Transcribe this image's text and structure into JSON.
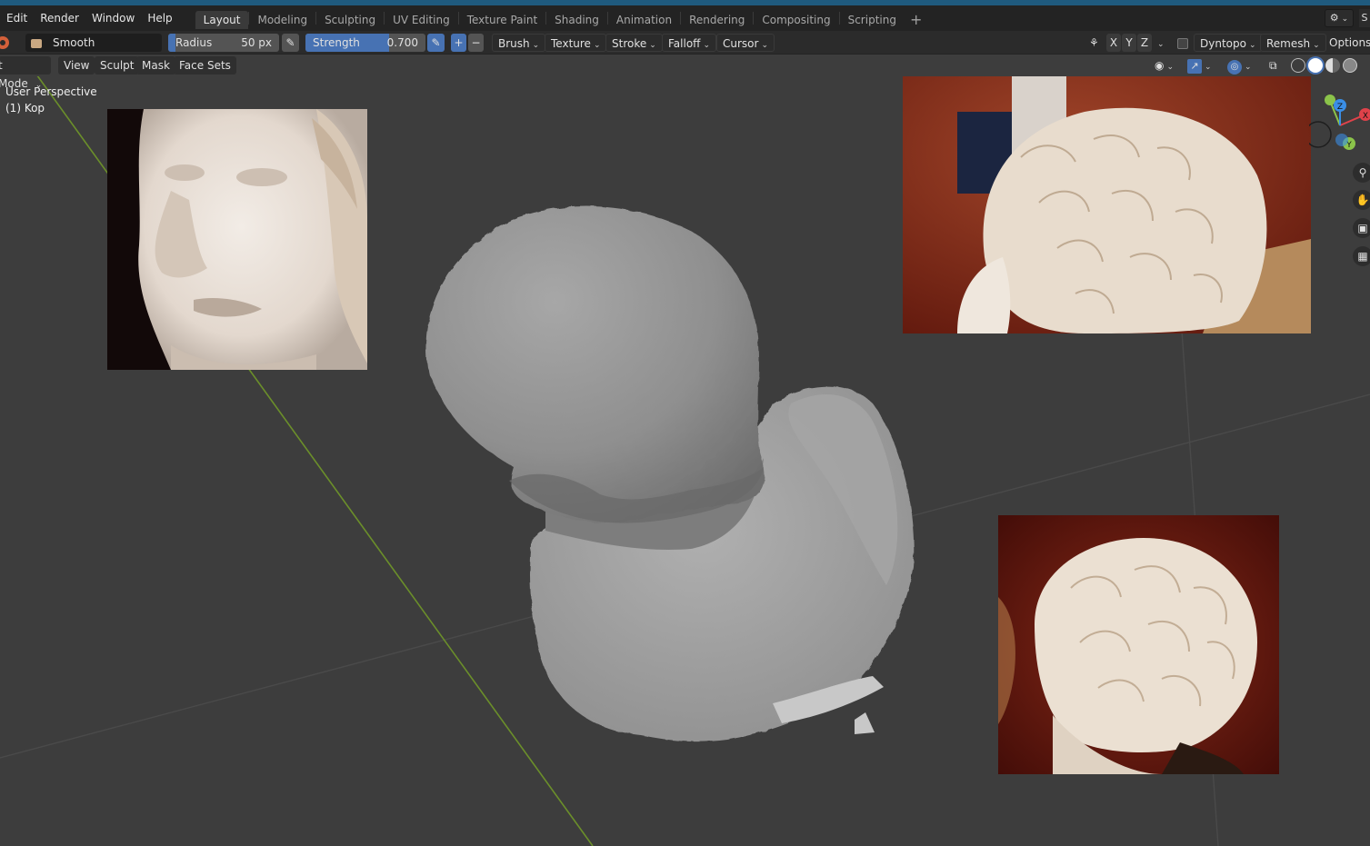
{
  "menubar": {
    "items": [
      "Edit",
      "Render",
      "Window",
      "Help"
    ],
    "workspaces": [
      "Layout",
      "Modeling",
      "Sculpting",
      "UV Editing",
      "Texture Paint",
      "Shading",
      "Animation",
      "Rendering",
      "Compositing",
      "Scripting"
    ],
    "active_workspace": "Layout",
    "add_symbol": "+",
    "right_edge": "S"
  },
  "tool_header": {
    "brush_name": "Smooth",
    "radius": {
      "label": "Radius",
      "value": "50 px"
    },
    "strength": {
      "label": "Strength",
      "value": "0.700",
      "level": 0.7
    },
    "plus": "+",
    "minus": "−",
    "dropdowns": [
      "Brush",
      "Texture",
      "Stroke",
      "Falloff",
      "Cursor"
    ],
    "axes": [
      "X",
      "Y",
      "Z"
    ],
    "dyntopo": "Dyntopo",
    "remesh": "Remesh",
    "options": "Options"
  },
  "viewport_header": {
    "mode": "t Mode",
    "menus": [
      "View",
      "Sculpt",
      "Mask",
      "Face Sets"
    ]
  },
  "viewport": {
    "perspective_label": "User Perspective",
    "object_label": "(1) Kop"
  },
  "gizmo": {
    "axes": [
      "X",
      "Y",
      "Z"
    ]
  },
  "colors": {
    "accent": "#4772b3",
    "background": "#3d3d3d",
    "x_axis": "#e0424a",
    "y_axis": "#8bc34a",
    "z_axis": "#3a8ee6",
    "line_y": "#6b8f2a"
  },
  "icons": {
    "brush": "brush-icon",
    "pen_pressure": "pen-pressure-icon",
    "symmetry": "butterfly-icon",
    "visibility": "eye-icon",
    "gizmo": "gizmo-icon",
    "overlay": "overlay-icon",
    "xray": "xray-icon",
    "zoom": "zoom-icon",
    "pan": "hand-icon",
    "camera": "camera-icon",
    "grid": "grid-icon"
  }
}
